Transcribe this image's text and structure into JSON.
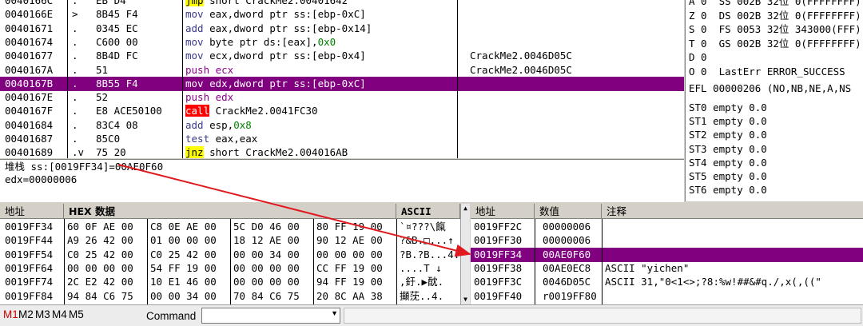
{
  "disasm": {
    "rows": [
      {
        "addr": "0040166C",
        "mark": ".",
        "bytes": "EB D4",
        "instr": [
          [
            "jmp",
            "jmp"
          ],
          [
            " short CrackMe2.00401642",
            ""
          ]
        ],
        "comment": ""
      },
      {
        "addr": "0040166E",
        "mark": ">",
        "bytes": "8B45 F4",
        "instr": [
          [
            "mov",
            "kw"
          ],
          [
            " eax,dword ptr ss:[ebp-0xC]",
            "reg"
          ]
        ],
        "comment": ""
      },
      {
        "addr": "00401671",
        "mark": ".",
        "bytes": "0345 EC",
        "instr": [
          [
            "add",
            "kw"
          ],
          [
            " eax,dword ptr ss:[ebp-0x14]",
            "reg"
          ]
        ],
        "comment": ""
      },
      {
        "addr": "00401674",
        "mark": ".",
        "bytes": "C600 00",
        "instr": [
          [
            "mov",
            "kw"
          ],
          [
            " byte ptr ds:[eax],",
            "reg"
          ],
          [
            "0x0",
            "num"
          ]
        ],
        "comment": ""
      },
      {
        "addr": "00401677",
        "mark": ".",
        "bytes": "8B4D FC",
        "instr": [
          [
            "mov",
            "kw"
          ],
          [
            " ecx,dword ptr ss:[ebp-0x4]",
            "reg"
          ]
        ],
        "comment": "CrackMe2.0046D05C"
      },
      {
        "addr": "0040167A",
        "mark": ".",
        "bytes": "51",
        "instr": [
          [
            "push ecx",
            "push"
          ]
        ],
        "comment": "CrackMe2.0046D05C"
      },
      {
        "addr": "0040167B",
        "mark": ".",
        "bytes": "8B55 F4",
        "instr": [
          [
            "mov",
            "kw"
          ],
          [
            " edx,dword ptr ss:[ebp-0xC]",
            "reg"
          ]
        ],
        "comment": "",
        "selected": true
      },
      {
        "addr": "0040167E",
        "mark": ".",
        "bytes": "52",
        "instr": [
          [
            "push edx",
            "push"
          ]
        ],
        "comment": ""
      },
      {
        "addr": "0040167F",
        "mark": ".",
        "bytes": "E8 ACE50100",
        "instr": [
          [
            "call",
            "call"
          ],
          [
            " CrackMe2.0041FC30",
            ""
          ]
        ],
        "comment": ""
      },
      {
        "addr": "00401684",
        "mark": ".",
        "bytes": "83C4 08",
        "instr": [
          [
            "add",
            "kw"
          ],
          [
            " esp,",
            "reg"
          ],
          [
            "0x8",
            "num"
          ]
        ],
        "comment": ""
      },
      {
        "addr": "00401687",
        "mark": ".",
        "bytes": "85C0",
        "instr": [
          [
            "test",
            "kw"
          ],
          [
            " eax,eax",
            "reg"
          ]
        ],
        "comment": ""
      },
      {
        "addr": "00401689",
        "mark": ".v",
        "bytes": "75 20",
        "instr": [
          [
            "jnz",
            "jmp"
          ],
          [
            " short CrackMe2.004016AB",
            ""
          ]
        ],
        "comment": ""
      }
    ]
  },
  "info": {
    "line1": "堆栈 ss:[0019FF34]=00AE0F60",
    "line2": "edx=00000006"
  },
  "registers": {
    "seg_rows": [
      "A 0  SS 002B 32位 0(FFFFFFFF)",
      "Z 0  DS 002B 32位 0(FFFFFFFF)",
      "S 0  FS 0053 32位 343000(FFF)",
      "T 0  GS 002B 32位 0(FFFFFFFF)",
      "D 0",
      "O 0  LastErr ERROR_SUCCESS"
    ],
    "efl": "EFL 00000206 (NO,NB,NE,A,NS",
    "fpu": [
      "ST0 empty 0.0",
      "ST1 empty 0.0",
      "ST2 empty 0.0",
      "ST3 empty 0.0",
      "ST4 empty 0.0",
      "ST5 empty 0.0",
      "ST6 empty 0.0"
    ]
  },
  "dump": {
    "headers": {
      "addr": "地址",
      "hex": "HEX 数据",
      "ascii": "ASCII"
    },
    "rows": [
      {
        "addr": "0019FF34",
        "h1": "60 0F AE 00",
        "h2": "C8 0E AE 00",
        "h3": "5C D0 46 00",
        "h4": "80 FF 19 00",
        "ascii": "`¤???\\餼"
      },
      {
        "addr": "0019FF44",
        "h1": "A9 26 42 00",
        "h2": "01 00 00 00",
        "h3": "18 12 AE 00",
        "h4": "90 12 AE 00",
        "ascii": "?&B.□...↑"
      },
      {
        "addr": "0019FF54",
        "h1": "C0 25 42 00",
        "h2": "C0 25 42 00",
        "h3": "00 00 34 00",
        "h4": "00 00 00 00",
        "ascii": "?B.?B...4."
      },
      {
        "addr": "0019FF64",
        "h1": "00 00 00 00",
        "h2": "54 FF 19 00",
        "h3": "00 00 00 00",
        "h4": "CC FF 19 00",
        "ascii": "....T ↓"
      },
      {
        "addr": "0019FF74",
        "h1": "2C E2 42 00",
        "h2": "10 E1 46 00",
        "h3": "00 00 00 00",
        "h4": "94 FF 19 00",
        "ascii": ",釪.▶酖."
      },
      {
        "addr": "0019FF84",
        "h1": "94 84 C6 75",
        "h2": "00 00 34 00",
        "h3": "70 84 C6 75",
        "h4": "20 8C AA 38",
        "ascii": "攧莐..4."
      }
    ]
  },
  "stack": {
    "headers": {
      "addr": "地址",
      "value": "数值",
      "comment": "注释"
    },
    "rows": [
      {
        "addr": "0019FF2C",
        "value": "00000006",
        "comment": ""
      },
      {
        "addr": "0019FF30",
        "value": "00000006",
        "comment": ""
      },
      {
        "addr": "0019FF34",
        "value": "00AE0F60",
        "comment": "",
        "selected": true
      },
      {
        "addr": "0019FF38",
        "value": "00AE0EC8",
        "comment": "ASCII \"yichen\""
      },
      {
        "addr": "0019FF3C",
        "value": "0046D05C",
        "comment": "ASCII 31,\"0<1<>;?8:%w!##&#q./,x(,((\""
      },
      {
        "addr": "0019FF40",
        "value": "r0019FF80",
        "comment": ""
      }
    ]
  },
  "bottom": {
    "m1": "M1",
    "m2": "M2",
    "m3": "M3",
    "m4": "M4",
    "m5": "M5",
    "command_label": "Command",
    "command_value": ""
  },
  "colors": {
    "selection": "#800080",
    "arrow": "#e0191e",
    "m1": "#cc0000"
  }
}
